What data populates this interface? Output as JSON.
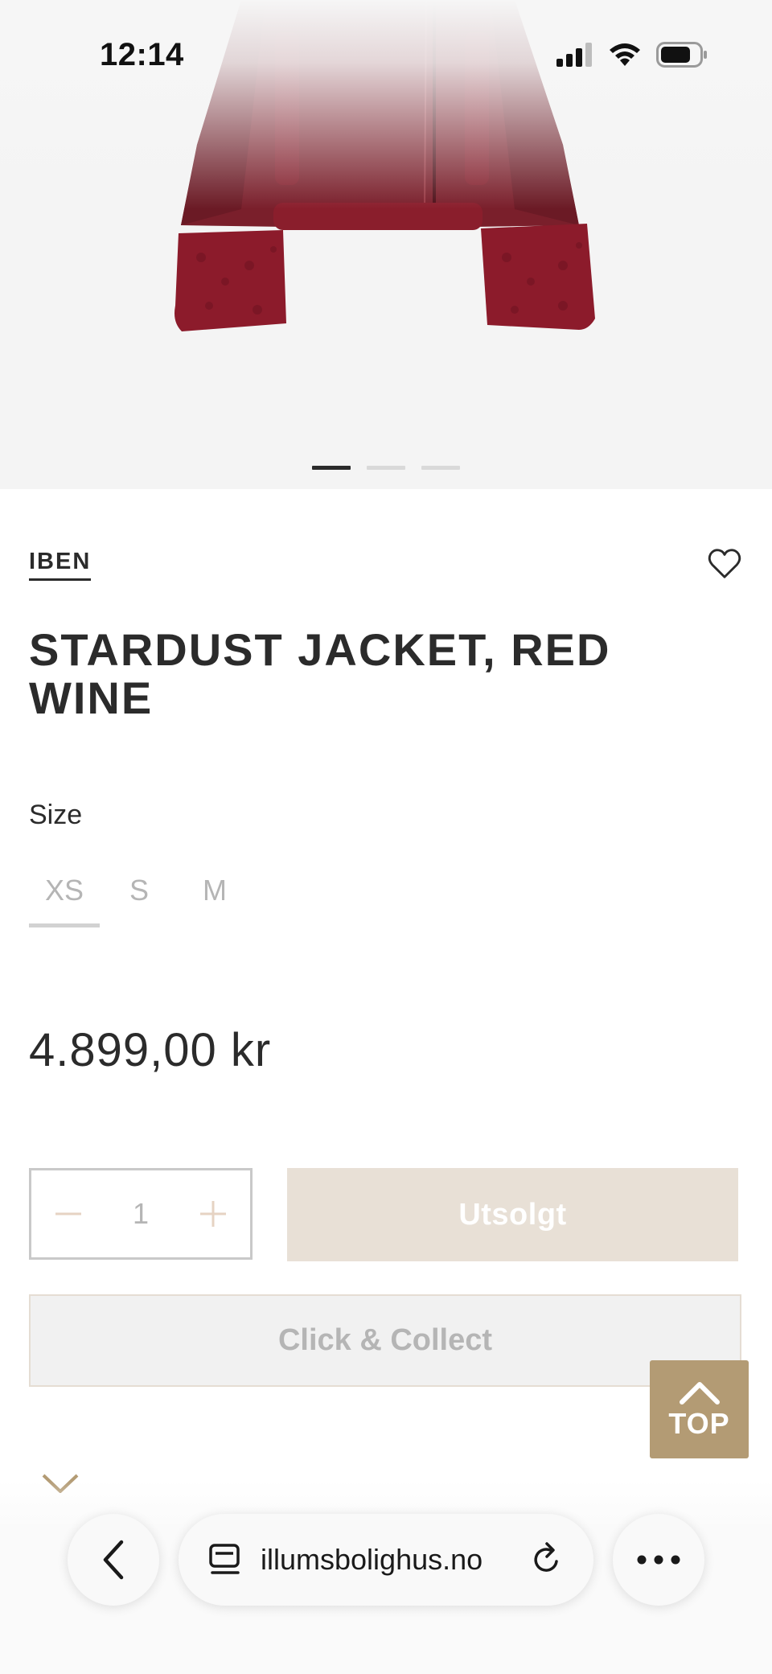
{
  "status_bar": {
    "time": "12:14"
  },
  "carousel": {
    "slides": 3,
    "active_index": 0
  },
  "product": {
    "brand": "IBEN",
    "title": "STARDUST JACKET, RED WINE",
    "size_label": "Size",
    "sizes": [
      "XS",
      "S",
      "M"
    ],
    "selected_size": "XS",
    "price": "4.899,00 kr",
    "quantity": "1",
    "sold_out_button": "Utsolgt",
    "click_collect_button": "Click & Collect",
    "back_to_top_label": "TOP"
  },
  "browser": {
    "url": "illumsbolighus.no"
  },
  "colors": {
    "product_wine": "#7a1f2b",
    "sold_out_bg": "#e8e0d6",
    "top_button_bg": "#b39b74",
    "text_dark": "#2b2b2b",
    "disabled_text": "#b5b5b5"
  },
  "icons": [
    "heart-icon",
    "minus-icon",
    "plus-icon",
    "chevron-up-icon",
    "chevron-down-icon",
    "back-chevron-icon",
    "tabs-icon",
    "reload-icon",
    "more-icon",
    "signal-icon",
    "wifi-icon",
    "battery-icon"
  ]
}
